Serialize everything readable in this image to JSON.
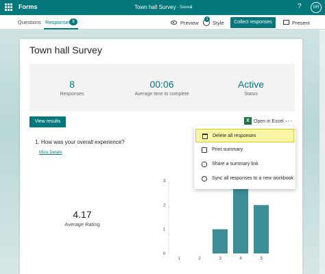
{
  "topbar": {
    "app_name": "Forms",
    "doc_title": "Town hall Survey",
    "saved": "-  Saved",
    "help": "?",
    "avatar": "SR"
  },
  "tabs": {
    "questions": "Questions",
    "responses": "Responses",
    "responses_count": "8"
  },
  "toolbar": {
    "preview": "Preview",
    "style": "Style",
    "style_badge": "1",
    "collect": "Collect responses",
    "present": "Present"
  },
  "survey": {
    "title": "Town hall Survey"
  },
  "stats": [
    {
      "value": "8",
      "label": "Responses"
    },
    {
      "value": "00:06",
      "label": "Average time to complete"
    },
    {
      "value": "Active",
      "label": "Status"
    }
  ],
  "actions": {
    "view_results": "View results",
    "open_excel": "Open in Excel",
    "more": "···"
  },
  "question": {
    "text": "1.  How was your overall experience?",
    "more_details": "More Details",
    "avg_value": "4.17",
    "avg_label": "Average Rating"
  },
  "menu": {
    "items": [
      {
        "label": "Delete all responses",
        "icon": "trash-icon"
      },
      {
        "label": "Print summary",
        "icon": "print-icon"
      },
      {
        "label": "Share a summary link",
        "icon": "link-icon"
      },
      {
        "label": "Sync all responses to a new workbook",
        "icon": "sync-icon"
      }
    ]
  },
  "colors": {
    "accent": "#03787c",
    "highlight": "#fbf6a6"
  },
  "chart_data": {
    "type": "bar",
    "categories": [
      "1",
      "2",
      "3",
      "4",
      "5"
    ],
    "values": [
      0,
      0,
      1,
      3,
      2
    ],
    "ylim": [
      0,
      3
    ],
    "yticks": [
      "0",
      "1",
      "2",
      "3"
    ],
    "grid": false
  }
}
